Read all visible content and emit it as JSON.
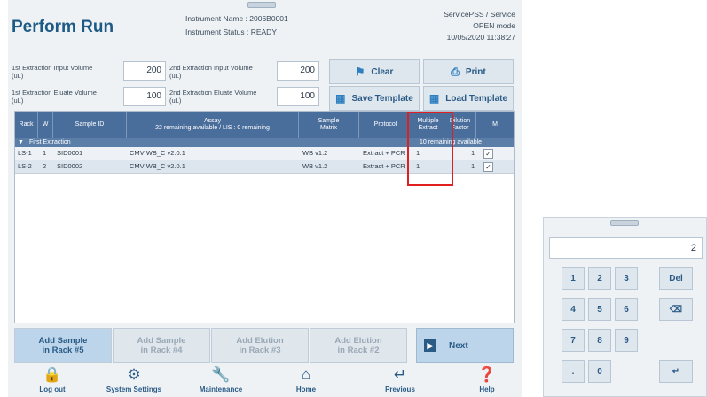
{
  "header": {
    "title": "Perform Run",
    "instrument_name": "Instrument Name : 2006B0001",
    "instrument_status": "Instrument Status : READY",
    "user": "ServicePSS / Service",
    "mode": "OPEN mode",
    "datetime": "10/05/2020 11:38:27"
  },
  "volumes": {
    "v1_label_1": "1st Extraction Input Volume",
    "v1_label_2": "(uL)",
    "v1_value": "200",
    "v2_label_1": "2nd Extraction Input Volume",
    "v2_label_2": "(uL)",
    "v2_value": "200",
    "v3_label_1": "1st Extraction Eluate Volume",
    "v3_label_2": "(uL)",
    "v3_value": "100",
    "v4_label_1": "2nd Extraction Eluate Volume",
    "v4_label_2": "(uL)",
    "v4_value": "100"
  },
  "toolbar": {
    "clear": "Clear",
    "print": "Print",
    "save_template": "Save Template",
    "load_template": "Load Template"
  },
  "table": {
    "headers": {
      "rack": "Rack",
      "w": "W",
      "sample_id": "Sample ID",
      "assay_1": "Assay",
      "assay_2": "22 remaining available / LIS : 0 remaining",
      "matrix_1": "Sample",
      "matrix_2": "Matrix",
      "protocol": "Protocol",
      "multiple_1": "Multiple",
      "multiple_2": "Extract",
      "dilution_1": "Dilution",
      "dilution_2": "Factor",
      "m": "M"
    },
    "group_label": "First Extraction",
    "group_remaining": "10 remaining available",
    "rows": [
      {
        "rack": "LS-1",
        "w": "1",
        "sample_id": "SID0001",
        "assay": "CMV WB_C v2.0.1",
        "matrix": "WB v1.2",
        "protocol": "Extract + PCR",
        "multiple": "1",
        "dilution": "1",
        "m": "✓"
      },
      {
        "rack": "LS-2",
        "w": "2",
        "sample_id": "SID0002",
        "assay": "CMV WB_C v2.0.1",
        "matrix": "WB v1.2",
        "protocol": "Extract + PCR",
        "multiple": "1",
        "dilution": "1",
        "m": "✓"
      }
    ]
  },
  "actions": {
    "add5_1": "Add Sample",
    "add5_2": "in Rack #5",
    "add4_1": "Add Sample",
    "add4_2": "in Rack #4",
    "el3_1": "Add Elution",
    "el3_2": "in Rack #3",
    "el2_1": "Add Elution",
    "el2_2": "in Rack #2",
    "next": "Next"
  },
  "nav": {
    "logout": "Log out",
    "settings": "System Settings",
    "maintenance": "Maintenance",
    "home": "Home",
    "previous": "Previous",
    "help": "Help"
  },
  "keypad": {
    "display": "2",
    "k1": "1",
    "k2": "2",
    "k3": "3",
    "del": "Del",
    "k4": "4",
    "k5": "5",
    "k6": "6",
    "k7": "7",
    "k8": "8",
    "k9": "9",
    "dot": ".",
    "k0": "0"
  },
  "icons": {
    "clear": "broom-icon",
    "print": "printer-icon",
    "template": "grid-icon",
    "next": "arrow-right-icon",
    "backspace": "backspace-icon",
    "enter": "enter-icon"
  },
  "colors": {
    "title": "#1e5a86",
    "table_header": "#4a6e9c",
    "highlight_box": "#e02020",
    "active_button": "#bcd5ea"
  }
}
